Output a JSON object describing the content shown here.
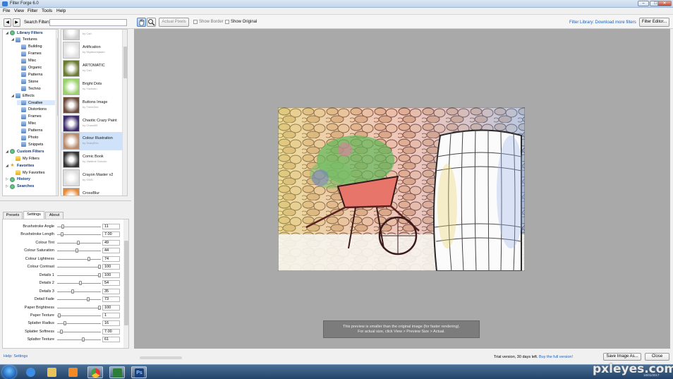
{
  "window": {
    "title": "Filter Forge 6.0",
    "caption_buttons": [
      "–",
      "□",
      "✕"
    ]
  },
  "menu": [
    "File",
    "View",
    "Filter",
    "Tools",
    "Help"
  ],
  "toolbar": {
    "back_icon": "◀",
    "forward_icon": "▶",
    "search_label": "Search Filters:",
    "search_value": "",
    "actual_pixels": "Actual Pixels",
    "show_border": "Show Border",
    "show_original": "Show Original",
    "library_link": "Filter Library: Download more filters",
    "filter_editor": "Filter Editor..."
  },
  "tree": [
    {
      "label": "Library Filters",
      "level": 0,
      "icon": "globe-icon",
      "expanded": true,
      "bold": true
    },
    {
      "label": "Textures",
      "level": 1,
      "icon": "category-icon",
      "expanded": true
    },
    {
      "label": "Building",
      "level": 2,
      "icon": "category-icon"
    },
    {
      "label": "Frames",
      "level": 2,
      "icon": "category-icon"
    },
    {
      "label": "Misc",
      "level": 2,
      "icon": "category-icon"
    },
    {
      "label": "Organic",
      "level": 2,
      "icon": "category-icon"
    },
    {
      "label": "Patterns",
      "level": 2,
      "icon": "category-icon"
    },
    {
      "label": "Stone",
      "level": 2,
      "icon": "category-icon"
    },
    {
      "label": "Techno",
      "level": 2,
      "icon": "category-icon"
    },
    {
      "label": "Effects",
      "level": 1,
      "icon": "category-icon",
      "expanded": true
    },
    {
      "label": "Creative",
      "level": 2,
      "icon": "category-icon",
      "selected": true
    },
    {
      "label": "Distortions",
      "level": 2,
      "icon": "category-icon"
    },
    {
      "label": "Frames",
      "level": 2,
      "icon": "category-icon"
    },
    {
      "label": "Misc",
      "level": 2,
      "icon": "category-icon"
    },
    {
      "label": "Patterns",
      "level": 2,
      "icon": "category-icon"
    },
    {
      "label": "Photo",
      "level": 2,
      "icon": "category-icon"
    },
    {
      "label": "Snippets",
      "level": 2,
      "icon": "category-icon"
    },
    {
      "label": "Custom Filters",
      "level": 0,
      "icon": "globe-icon",
      "expanded": true,
      "bold": true
    },
    {
      "label": "My Filters",
      "level": 1,
      "icon": "folder-icon"
    },
    {
      "label": "Favorites",
      "level": 0,
      "icon": "star-icon",
      "expanded": true,
      "bold": true
    },
    {
      "label": "My Favorites",
      "level": 1,
      "icon": "folder-icon"
    },
    {
      "label": "History",
      "level": 0,
      "icon": "clock-icon",
      "expanded": false,
      "bold": true
    },
    {
      "label": "Searches",
      "level": 0,
      "icon": "search-icon",
      "expanded": false,
      "bold": true
    }
  ],
  "filters": [
    {
      "name": "",
      "by": "by Carl"
    },
    {
      "name": "Artification",
      "by": "by Skybluemjaam"
    },
    {
      "name": "ARTOMATIC",
      "by": "by Carl"
    },
    {
      "name": "Bright Dots",
      "by": "by Yuchuku"
    },
    {
      "name": "Buttons Image",
      "by": "by ThreeZee"
    },
    {
      "name": "Chaotic Crazy Paint",
      "by": "by Chaos55"
    },
    {
      "name": "Colour Illustration",
      "by": "by ScaryEric",
      "selected": true
    },
    {
      "name": "Comic Book",
      "by": "by Vladimir Golovin"
    },
    {
      "name": "Crayon Master v2",
      "by": "by GMG"
    },
    {
      "name": "CrossBlur",
      "by": ""
    }
  ],
  "tabs": [
    {
      "label": "Presets"
    },
    {
      "label": "Settings",
      "active": true
    },
    {
      "label": "About"
    }
  ],
  "settings": [
    {
      "label": "Brushstroke Angle",
      "value": "11",
      "level": 0.1
    },
    {
      "label": "Brushstroke Length",
      "value": "7.00",
      "level": 0.08
    },
    {
      "label": "Colour Tint",
      "value": "49",
      "level": 0.49
    },
    {
      "label": "Colour Saturation",
      "value": "44",
      "level": 0.44
    },
    {
      "label": "Colour Lightness",
      "value": "74",
      "level": 0.74
    },
    {
      "label": "Colour Contrast",
      "value": "100",
      "level": 1.0
    },
    {
      "label": "Details 1",
      "value": "100",
      "level": 1.0
    },
    {
      "label": "Details 2",
      "value": "54",
      "level": 0.54
    },
    {
      "label": "Details 3",
      "value": "35",
      "level": 0.35
    },
    {
      "label": "Detail Fade",
      "value": "73",
      "level": 0.73
    },
    {
      "label": "Paper  Brightness",
      "value": "100",
      "level": 1.0
    },
    {
      "label": "Paper Texture",
      "value": "1",
      "level": 0.01
    },
    {
      "label": "Splatter Radius",
      "value": "16",
      "level": 0.16
    },
    {
      "label": "Splatter Softness",
      "value": "7.00",
      "level": 0.07
    },
    {
      "label": "Splatter Texture",
      "value": "61",
      "level": 0.61
    }
  ],
  "help_link": "Help: Settings",
  "preview_notice_line1": "This preview is smaller than the original image (for faster rendering).",
  "preview_notice_line2": "For actual size, click View > Preview Size > Actual.",
  "status": {
    "trial": "Trial version, 30 days left.",
    "buy": "Buy the full version!"
  },
  "buttons": {
    "save": "Save Image As...",
    "close": "Close"
  },
  "taskbar": {
    "items": [
      {
        "name": "internet-explorer-icon",
        "color": "#3a8ee6"
      },
      {
        "name": "file-explorer-icon",
        "color": "#e8c35a"
      },
      {
        "name": "media-player-icon",
        "color": "#f08a24"
      },
      {
        "name": "chrome-icon",
        "color": "#4caf50",
        "active": true
      },
      {
        "name": "filter-forge-icon",
        "color": "#2f7d3a",
        "active": true
      },
      {
        "name": "photoshop-icon",
        "color": "#1b3f7a",
        "active": true,
        "text": "Ps"
      }
    ],
    "clock": "16/01/2017"
  },
  "watermark": "pxleyes.com",
  "colors": {
    "accent_link": "#1b5fbf",
    "preview_bg": "#a9a9a9",
    "selection": "#cfe2fa"
  }
}
